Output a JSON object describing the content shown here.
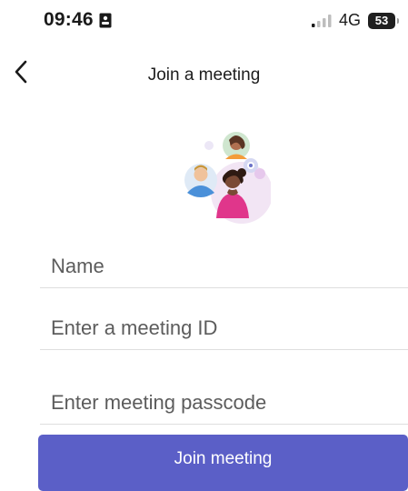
{
  "status_bar": {
    "time": "09:46",
    "network": "4G",
    "battery": "53",
    "icons": [
      "id-card-icon",
      "signal-icon"
    ]
  },
  "header": {
    "back_icon": "chevron-left-icon",
    "title": "Join a meeting"
  },
  "illustration": {
    "icon": "people-illustration-icon"
  },
  "form": {
    "name_placeholder": "Name",
    "meeting_id_placeholder": "Enter a meeting ID",
    "passcode_placeholder": "Enter meeting passcode",
    "name_value": "",
    "meeting_id_value": "",
    "passcode_value": ""
  },
  "actions": {
    "join_label": "Join meeting"
  },
  "colors": {
    "accent": "#5b5fc7",
    "divider": "#dedede",
    "text": "#1a1a1a"
  }
}
